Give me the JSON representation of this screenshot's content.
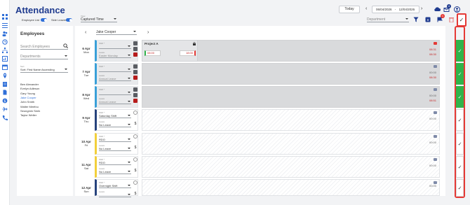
{
  "header": {
    "title": "Attendance",
    "today_label": "Today",
    "date_from": "06/04/2026",
    "date_sep": "-",
    "date_to": "12/04/2026",
    "notification_count": "4"
  },
  "toolbar": {
    "employee_list_label": "Employee List",
    "side_leaves_label": "Side Leaves",
    "view_label": "View",
    "view_value": "Captured Time",
    "department_placeholder": "Department",
    "flag_count": "1"
  },
  "employees": {
    "heading": "Employees",
    "search_placeholder": "Search Employees",
    "department_placeholder": "Departments",
    "sort_label": "Sort",
    "sort_value": "Sort: First Name Ascending",
    "list": [
      "Ben Alexander",
      "Evelyn Adleson",
      "Gary Young",
      "Jake Cooper",
      "John Smith",
      "Walter Meefou",
      "Seungmin Seek",
      "Taylor Weller"
    ],
    "active_index": 3
  },
  "main": {
    "selected_employee": "Jake Cooper",
    "project_label": "Project A",
    "start_time": "08:00",
    "end_time": "18:00",
    "days": [
      {
        "day": "6 Apr",
        "dow": "Mon",
        "shift_label": "Shift *",
        "shift": "",
        "leave_label": "Leave",
        "leave": "Easter Monday",
        "hours_a": "08:31",
        "hours_b": "08:30",
        "approved": true
      },
      {
        "day": "7 Apr",
        "dow": "Tue",
        "shift_label": "Shift *",
        "shift": "",
        "leave_label": "Leave",
        "leave": "Annual Leave",
        "hours_a": "00:00",
        "hours_b": "08:30",
        "approved": true
      },
      {
        "day": "8 Apr",
        "dow": "Wed",
        "shift_label": "Shift *",
        "shift": "",
        "leave_label": "Leave",
        "leave": "Annual Leave",
        "hours_a": "00:00",
        "hours_b": "08:51",
        "approved": true
      },
      {
        "day": "9 Apr",
        "dow": "Thu",
        "shift_label": "Shift *",
        "shift": "Saturday Shift",
        "leave_label": "Leave",
        "leave": "No Leave",
        "hours_a": "00:00",
        "hours_b": "",
        "approved": false
      },
      {
        "day": "10 Apr",
        "dow": "Fri",
        "shift_label": "Shift *",
        "shift": "RDO",
        "leave_label": "Leave",
        "leave": "No Leave",
        "hours_a": "00:00",
        "hours_b": "",
        "approved": false
      },
      {
        "day": "11 Apr",
        "dow": "Sat",
        "shift_label": "Shift *",
        "shift": "RDO",
        "leave_label": "Leave",
        "leave": "No Leave",
        "hours_a": "00:00",
        "hours_b": "",
        "approved": false
      },
      {
        "day": "12 Apr",
        "dow": "Sun",
        "shift_label": "Shift *",
        "shift": "Overnight Shift",
        "leave_label": "Leave",
        "leave": "",
        "hours_a": "00:00",
        "hours_b": "",
        "approved": false
      }
    ]
  },
  "approval": {
    "check_glyph": "✓"
  },
  "colors": {
    "brand": "#1f3b8f",
    "accent": "#2f6fd8",
    "approved": "#2fb34a",
    "highlight": "#e53935",
    "card_border_blue": "#3aa0d8",
    "card_border_yellow": "#f2cf3b",
    "card_border_navy": "#27437c"
  }
}
